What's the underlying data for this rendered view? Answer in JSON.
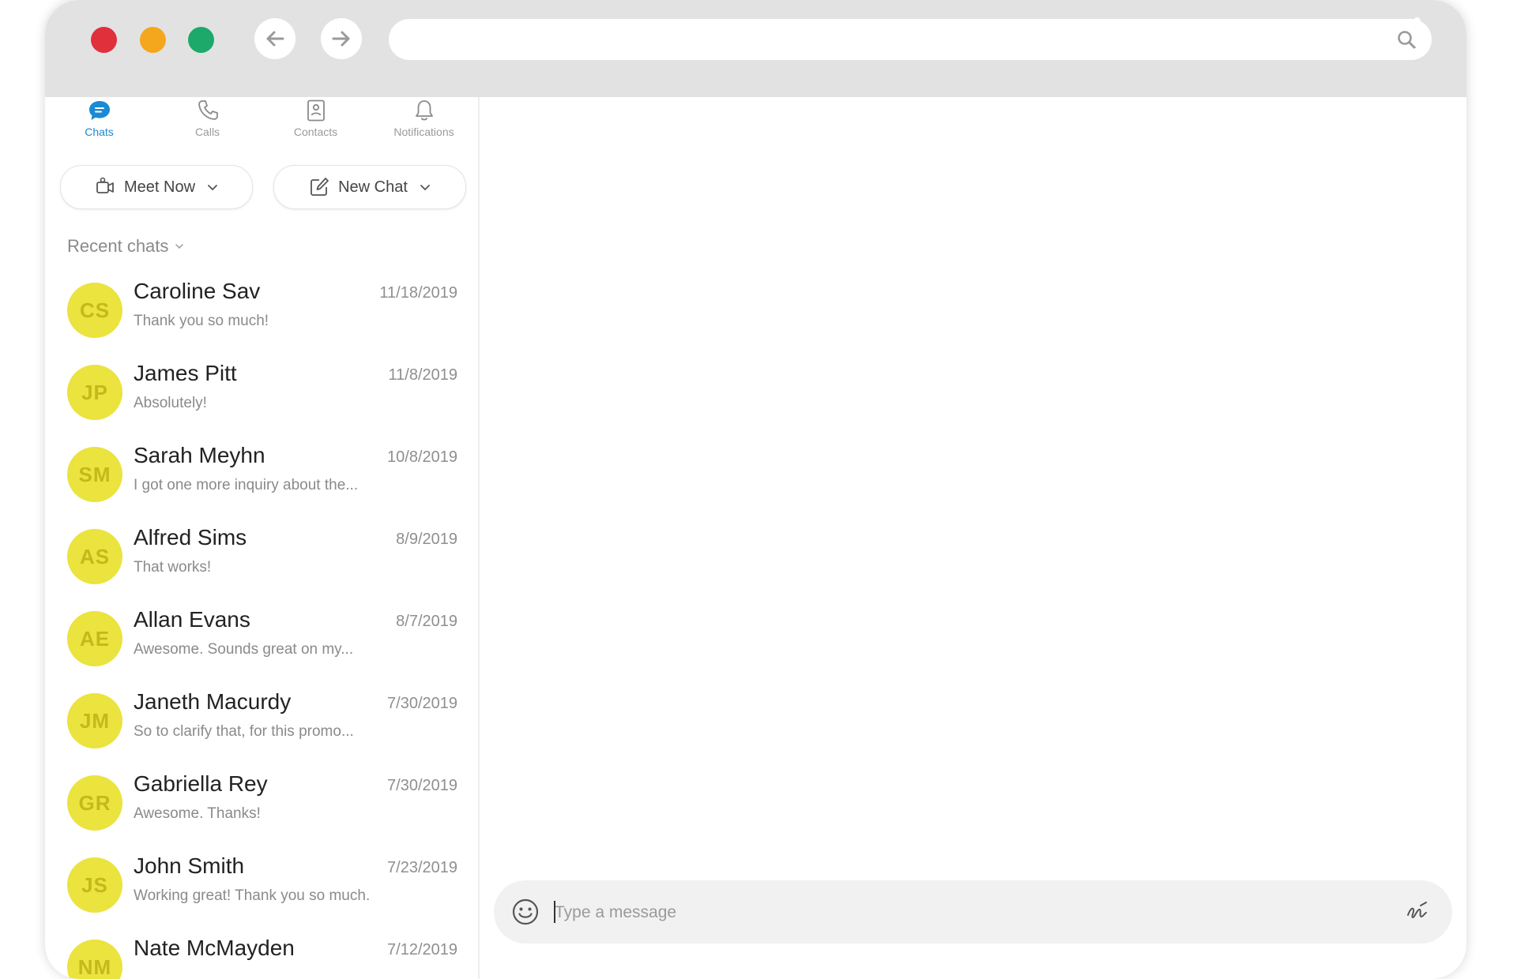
{
  "browser": {
    "address_value": "",
    "colors": {
      "close": "#e0303b",
      "minimize": "#f4a71d",
      "maximize": "#1da96a"
    }
  },
  "tabs": [
    {
      "label": "Chats",
      "icon": "chat-bubble-icon",
      "active": true
    },
    {
      "label": "Calls",
      "icon": "phone-icon",
      "active": false
    },
    {
      "label": "Contacts",
      "icon": "contact-card-icon",
      "active": false
    },
    {
      "label": "Notifications",
      "icon": "bell-icon",
      "active": false
    }
  ],
  "actions": {
    "meet_now": "Meet Now",
    "new_chat": "New Chat"
  },
  "recent_header": "Recent chats",
  "chats": [
    {
      "initials": "CS",
      "name": "Caroline Sav",
      "date": "11/18/2019",
      "preview": "Thank you so much!"
    },
    {
      "initials": "JP",
      "name": "James Pitt",
      "date": "11/8/2019",
      "preview": "Absolutely!"
    },
    {
      "initials": "SM",
      "name": "Sarah Meyhn",
      "date": "10/8/2019",
      "preview": "I got one more inquiry about the..."
    },
    {
      "initials": "AS",
      "name": "Alfred Sims",
      "date": "8/9/2019",
      "preview": "That works!"
    },
    {
      "initials": "AE",
      "name": "Allan Evans",
      "date": "8/7/2019",
      "preview": "Awesome. Sounds great on my..."
    },
    {
      "initials": "JM",
      "name": "Janeth Macurdy",
      "date": "7/30/2019",
      "preview": "So to clarify that, for this promo..."
    },
    {
      "initials": "GR",
      "name": "Gabriella Rey",
      "date": "7/30/2019",
      "preview": "Awesome. Thanks!"
    },
    {
      "initials": "JS",
      "name": "John Smith",
      "date": "7/23/2019",
      "preview": "Working great! Thank you so much."
    },
    {
      "initials": "NM",
      "name": "Nate McMayden",
      "date": "7/12/2019",
      "preview": ""
    }
  ],
  "composer": {
    "placeholder": "Type a message",
    "value": ""
  },
  "accent_color": "#1a8ad4",
  "avatar_color": "#ebe33e"
}
